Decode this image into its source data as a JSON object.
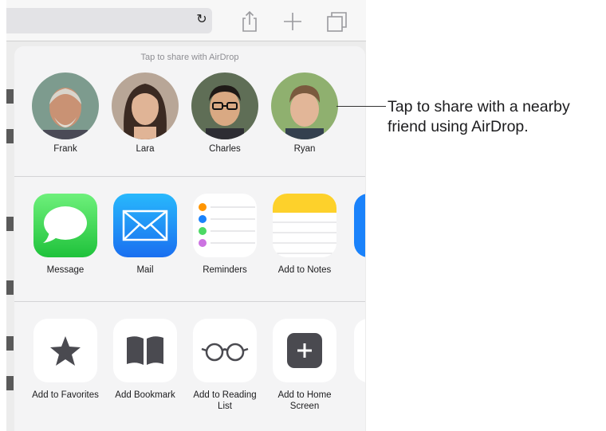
{
  "sheet": {
    "airdrop_hint": "Tap to share with AirDrop",
    "people": [
      {
        "name": "Frank"
      },
      {
        "name": "Lara"
      },
      {
        "name": "Charles"
      },
      {
        "name": "Ryan"
      }
    ],
    "apps": [
      {
        "label": "Message",
        "icon": "message-icon",
        "color": "#4cd964"
      },
      {
        "label": "Mail",
        "icon": "mail-icon",
        "color": "#1a82fb"
      },
      {
        "label": "Reminders",
        "icon": "reminders-icon"
      },
      {
        "label": "Add to Notes",
        "icon": "notes-icon",
        "color": "#fdd12b"
      }
    ],
    "actions": [
      {
        "label": "Add to Favorites",
        "icon": "star-icon"
      },
      {
        "label": "Add Bookmark",
        "icon": "book-icon"
      },
      {
        "label": "Add to Reading List",
        "icon": "glasses-icon"
      },
      {
        "label": "Add to Home Screen",
        "icon": "add-square-icon"
      }
    ]
  },
  "toolbar": {
    "reload_glyph": "↻"
  },
  "callout": {
    "text": "Tap to share with a nearby friend using AirDrop."
  },
  "colors": {
    "sheet_bg": "#f4f4f5",
    "text": "#1c1c1e",
    "hint": "#8e8e93"
  }
}
